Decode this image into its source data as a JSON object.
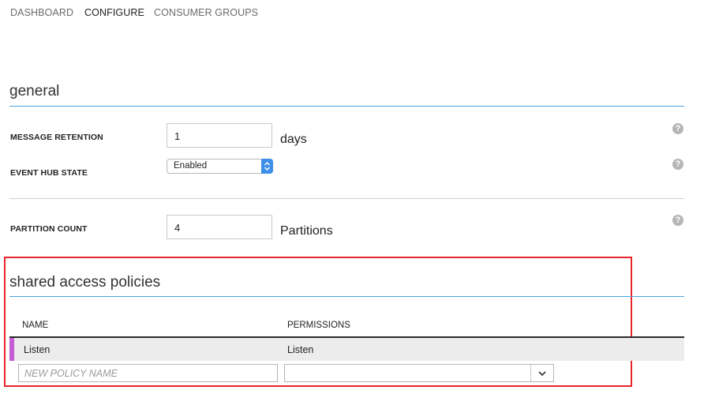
{
  "tabs": [
    {
      "label": "DASHBOARD",
      "active": false
    },
    {
      "label": "CONFIGURE",
      "active": true
    },
    {
      "label": "CONSUMER GROUPS",
      "active": false
    }
  ],
  "general": {
    "title": "general",
    "message_retention": {
      "label": "MESSAGE RETENTION",
      "value": "1",
      "unit": "days"
    },
    "event_hub_state": {
      "label": "EVENT HUB STATE",
      "value": "Enabled"
    },
    "partition_count": {
      "label": "PARTITION COUNT",
      "value": "4",
      "unit": "Partitions"
    },
    "help_glyph": "?"
  },
  "shared_access": {
    "title": "shared access policies",
    "columns": {
      "name": "NAME",
      "permissions": "PERMISSIONS"
    },
    "rows": [
      {
        "name": "Listen",
        "permissions": "Listen"
      }
    ],
    "new_policy_placeholder": "NEW POLICY NAME",
    "permissions_select_value": ""
  },
  "colors": {
    "accent_blue": "#4aa3df",
    "highlight_red": "#e8232a",
    "row_accent": "#c85bd6",
    "select_blue": "#3d8ee6"
  }
}
